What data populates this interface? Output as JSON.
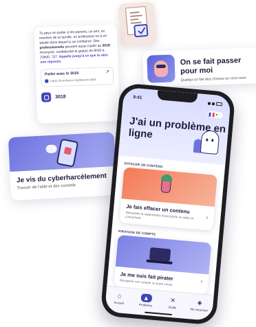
{
  "info_card": {
    "text_prefix": "Tu peux en parler à tes parents, un ami, un membre de ta famille, un professeur ou à un adulte dans lequel tu as confiance.",
    "text_pros_a": "Des ",
    "text_pros_b": "professionnels",
    "text_pros_c": " peuvent aussi t'aider au ",
    "number_bold": "3018",
    "text_mid": ". Anonyme, confidentiel et gratuit de 9h00 à 23h00, 7j/7. ",
    "text_link": "Appelle jusqu'à ce que tu aies une réponse.",
    "call_title": "Parler avec le 3018",
    "call_url": "https://e-enfance.org/besoin-daid...",
    "number_label": "3018"
  },
  "impersonation_card": {
    "title": "On se fait passer pour moi",
    "subtitle": "Quelqu'un fait des choses en mon nom"
  },
  "cyber_card": {
    "title": "Je vis du cyberharcèlement",
    "subtitle": "Trouver de l'aide et des conseils"
  },
  "phone": {
    "time": "9:41",
    "page_title": "J'ai un problème en ligne",
    "section_1": "EFFACER UN CONTENU",
    "feature_1": {
      "title": "Je fais effacer un contenu",
      "subtitle": "Demander la suppression d'une photo ou vidéo te concernant."
    },
    "section_2": "PIRATAGE DE COMPTE",
    "feature_2": {
      "title": "Je me suis fait pirater",
      "subtitle": "Récupérer son compte ou autre chose"
    },
    "tabs": [
      {
        "label": "Accueil",
        "icon": "home-icon",
        "active": false
      },
      {
        "label": "Problème",
        "icon": "warning-icon",
        "active": true
      },
      {
        "label": "Outils",
        "icon": "tools-icon",
        "active": false
      },
      {
        "label": "Me sécuriser",
        "icon": "shield-icon",
        "active": false
      }
    ]
  },
  "colors": {
    "accent": "#3f46b8",
    "lavender": "#d9dbff",
    "orange": "#f47a55"
  }
}
